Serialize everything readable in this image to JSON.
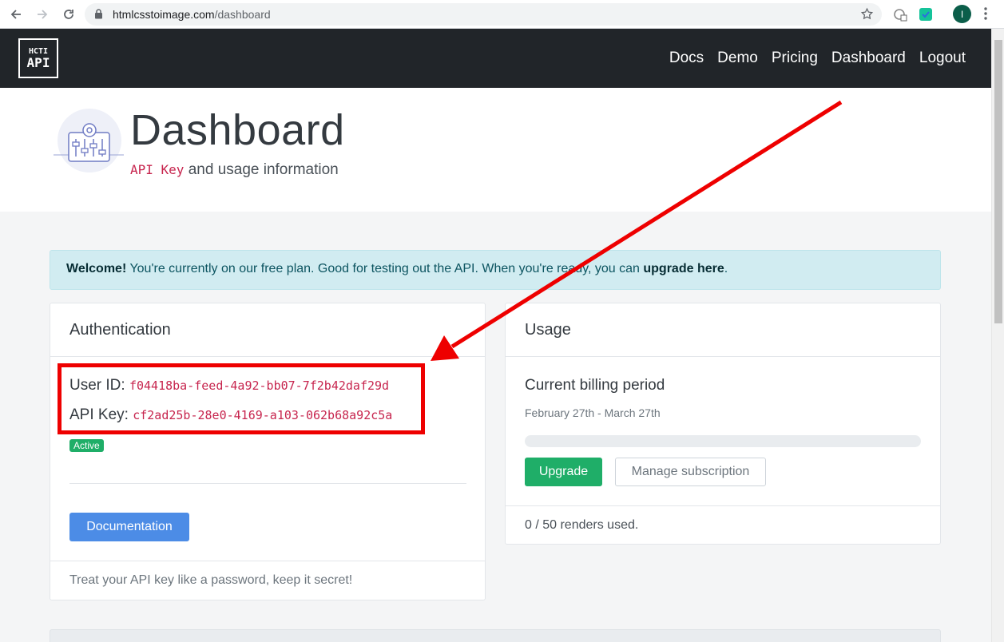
{
  "browser": {
    "url_host": "htmlcsstoimage.com",
    "url_path": "/dashboard",
    "profile_initial": "I"
  },
  "navbar": {
    "brand_line1": "HCTI",
    "brand_line2": "API",
    "links": [
      "Docs",
      "Demo",
      "Pricing",
      "Dashboard",
      "Logout"
    ]
  },
  "header": {
    "title": "Dashboard",
    "subtitle_code": "API Key",
    "subtitle_text": " and usage information"
  },
  "alert": {
    "bold_lead": "Welcome!",
    "text": " You're currently on our free plan. Good for testing out the API. When you're ready, you can ",
    "link": "upgrade here",
    "suffix": "."
  },
  "auth": {
    "title": "Authentication",
    "user_id_label": "User ID: ",
    "user_id": "f04418ba-feed-4a92-bb07-7f2b42daf29d",
    "api_key_label": "API Key: ",
    "api_key": "cf2ad25b-28e0-4169-a103-062b68a92c5a",
    "status_badge": "Active",
    "documentation_button": "Documentation",
    "footer": "Treat your API key like a password, keep it secret!"
  },
  "usage": {
    "title": "Usage",
    "billing_title": "Current billing period",
    "billing_range": "February 27th - March 27th",
    "progress_fraction": 0,
    "upgrade_button": "Upgrade",
    "manage_button": "Manage subscription",
    "renders_used": "0 / 50 renders used."
  },
  "colors": {
    "navbar": "#212529",
    "alert_bg": "#d1ecf1",
    "code": "#c7254e",
    "primary": "#4c8ce6",
    "success": "#1fae68",
    "annotation": "#ee0000"
  }
}
